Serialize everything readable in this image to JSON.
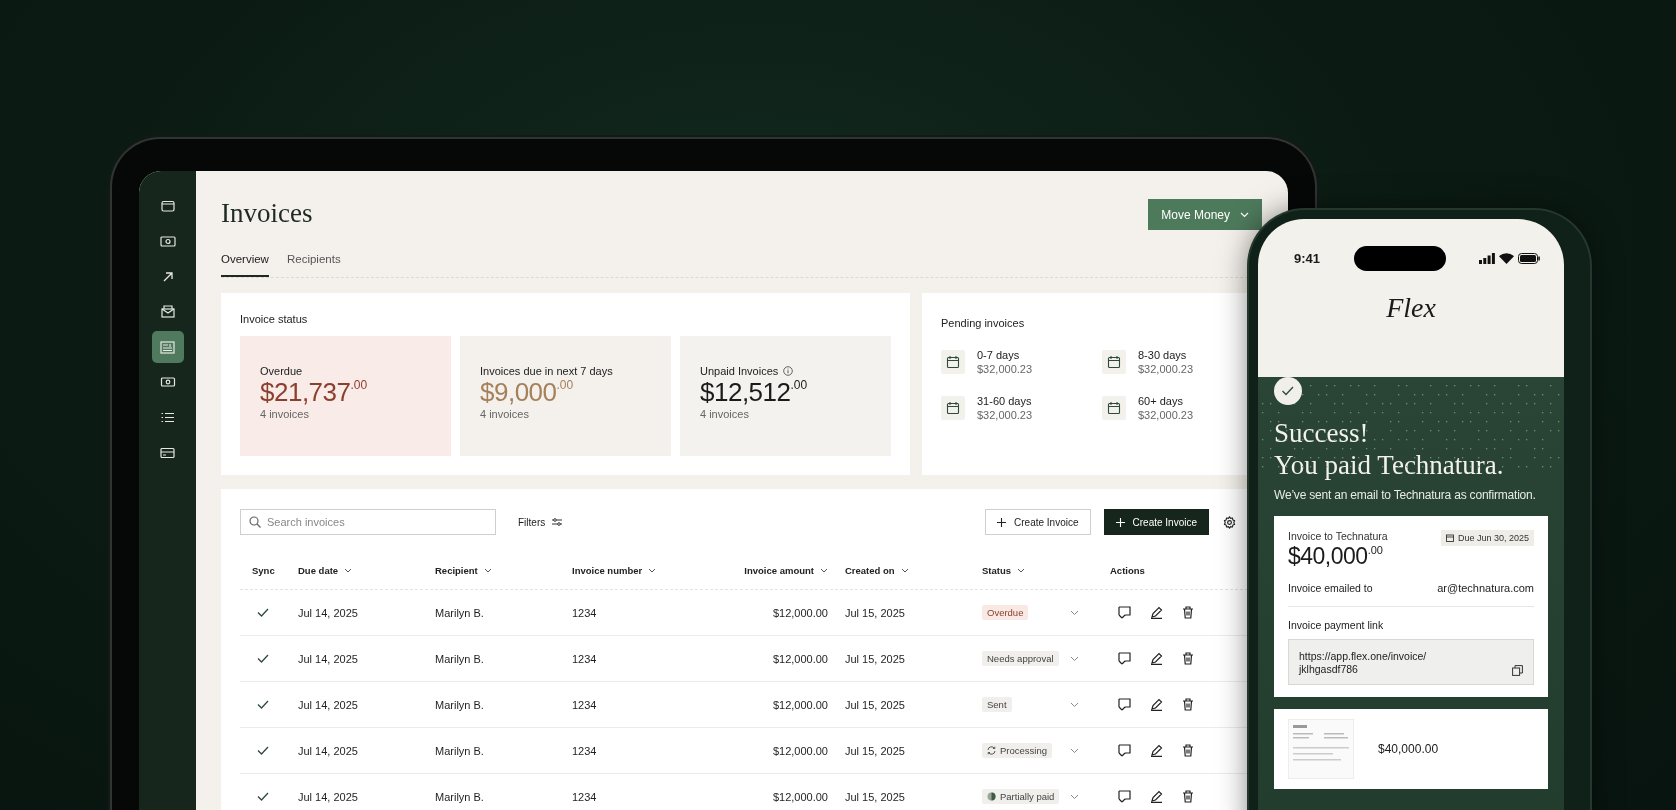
{
  "sidebar": {
    "items": [
      {
        "kind": "wallet",
        "selected": false
      },
      {
        "kind": "cash",
        "selected": false
      },
      {
        "kind": "arrow",
        "selected": false
      },
      {
        "kind": "inbox",
        "selected": false
      },
      {
        "kind": "invoice",
        "selected": true
      },
      {
        "kind": "exchange",
        "selected": false
      },
      {
        "kind": "list",
        "selected": false
      },
      {
        "kind": "card",
        "selected": false
      }
    ]
  },
  "page": {
    "title": "Invoices",
    "action_button": "Move Money"
  },
  "tabs": [
    {
      "label": "Overview",
      "selected": true
    },
    {
      "label": "Recipients",
      "selected": false
    }
  ],
  "invoice_status": {
    "title": "Invoice status",
    "cards": [
      {
        "kind": "overdue",
        "label": "Overdue",
        "info": false,
        "amount": "$21,737$^{.00}$",
        "count": "4 invoices"
      },
      {
        "kind": "upcoming",
        "label": "Invoices due in next 7 days",
        "info": false,
        "amount": "$9,000$^{.00}$",
        "count": "4 invoices"
      },
      {
        "kind": "unpaid",
        "label": "Unpaid Invoices",
        "info": true,
        "amount": "$12,512$^{.00}$",
        "count": "4 invoices"
      }
    ]
  },
  "pending_invoices": {
    "title": "Pending invoices",
    "buckets": [
      {
        "range": "0-7 days",
        "amount": "$32,000.23"
      },
      {
        "range": "8-30 days",
        "amount": "$32,000.23"
      },
      {
        "range": "31-60 days",
        "amount": "$32,000.23"
      },
      {
        "range": "60+ days",
        "amount": "$32,000.23"
      }
    ]
  },
  "toolbar": {
    "search": {
      "placeholder": "Search invoices"
    },
    "filters": "Filters",
    "buttons": [
      {
        "kind": "outline",
        "label": "Create Invoice"
      },
      {
        "kind": "primary",
        "label": "Create Invoice"
      }
    ]
  },
  "table": {
    "columns": [
      {
        "label": "Sync",
        "sortable": false
      },
      {
        "label": "Due date",
        "sortable": true
      },
      {
        "label": "Recipient",
        "sortable": true
      },
      {
        "label": "Invoice number",
        "sortable": true
      },
      {
        "label": "Invoice amount",
        "sortable": true
      },
      {
        "label": "Created on",
        "sortable": true
      },
      {
        "label": "Status",
        "sortable": true
      },
      {
        "label": "Actions",
        "sortable": false
      }
    ],
    "rows": [
      {
        "synced": true,
        "due_date": "Jul 14, 2025",
        "recipient": "Marilyn B.",
        "invoice_number": "1234",
        "amount": "$12,000.00",
        "created_on": "Jul 15, 2025",
        "status": {
          "kind": "overdue",
          "label": "Overdue"
        }
      },
      {
        "synced": true,
        "due_date": "Jul 14, 2025",
        "recipient": "Marilyn B.",
        "invoice_number": "1234",
        "amount": "$12,000.00",
        "created_on": "Jul 15, 2025",
        "status": {
          "kind": "approval",
          "label": "Needs approval"
        }
      },
      {
        "synced": true,
        "due_date": "Jul 14, 2025",
        "recipient": "Marilyn B.",
        "invoice_number": "1234",
        "amount": "$12,000.00",
        "created_on": "Jul 15, 2025",
        "status": {
          "kind": "sent",
          "label": "Sent"
        }
      },
      {
        "synced": true,
        "due_date": "Jul 14, 2025",
        "recipient": "Marilyn B.",
        "invoice_number": "1234",
        "amount": "$12,000.00",
        "created_on": "Jul 15, 2025",
        "status": {
          "kind": "processing",
          "label": "Processing"
        }
      },
      {
        "synced": true,
        "due_date": "Jul 14, 2025",
        "recipient": "Marilyn B.",
        "invoice_number": "1234",
        "amount": "$12,000.00",
        "created_on": "Jul 15, 2025",
        "status": {
          "kind": "partial",
          "label": "Partially paid"
        }
      }
    ]
  },
  "phone": {
    "status_bar": {
      "time": "9:41"
    },
    "brand": "Flex",
    "success": {
      "heading": "Success!",
      "subheading": "You paid Technatura.",
      "message": "We’ve sent an email to Technatura as confirmation."
    },
    "invoice": {
      "title": "Invoice to Technatura",
      "amount": "$40,000$^{.00}$",
      "due": "Due Jun 30, 2025",
      "emailed_label": "Invoice emailed to",
      "email": "ar@technatura.com",
      "link_label": "Invoice payment link",
      "link": "https://app.flex.one/invoice/jklhgasdf786"
    },
    "preview": {
      "amount": "$40,000.00"
    }
  }
}
